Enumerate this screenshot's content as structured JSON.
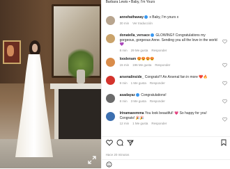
{
  "caption": {
    "author": "Barbara Lewis",
    "text": " • Baby, I'm Yours"
  },
  "comments": [
    {
      "user": "annehathaway",
      "verified": true,
      "text": "x Baby, I'm yours x",
      "time": "30 min",
      "likes": "",
      "reply": "Ver traducción",
      "avatar_color": "#b8a58f"
    },
    {
      "user": "donatella_versace",
      "verified": true,
      "text": "GLOWING!! Congratulations my gorgeous, gorgeous Anne. Sending you all the love in the world 💜",
      "time": "8 min",
      "likes": "29 Me gusta",
      "reply": "Responder",
      "avatar_color": "#caa36b"
    },
    {
      "user": "loodenam",
      "verified": false,
      "text": "😍😍😍😍",
      "time": "15 min",
      "likes": "196 Me gusta",
      "reply": "Responder",
      "avatar_color": "#d98c4a"
    },
    {
      "user": "arsenalinside_",
      "verified": false,
      "text": "Congrats!!! An Arsenal fan in more ❤️🔥",
      "time": "9 min",
      "likes": "1 Me gusta",
      "reply": "Responder",
      "avatar_color": "#d4332c"
    },
    {
      "user": "asadayaz",
      "verified": true,
      "text": "Congratulations!",
      "time": "8 min",
      "likes": "3 Me gusta",
      "reply": "Responder",
      "avatar_color": "#6b6b6b"
    },
    {
      "user": "lrinamaeemma",
      "verified": false,
      "text": "You look beautiful! 💗 So happy for you! Congrats! 🎉🎉",
      "time": "12 min",
      "likes": "1 Me gusta",
      "reply": "Responder",
      "avatar_color": "#3c6fb0"
    }
  ],
  "footer": {
    "date": "Hace 20 minutos"
  }
}
